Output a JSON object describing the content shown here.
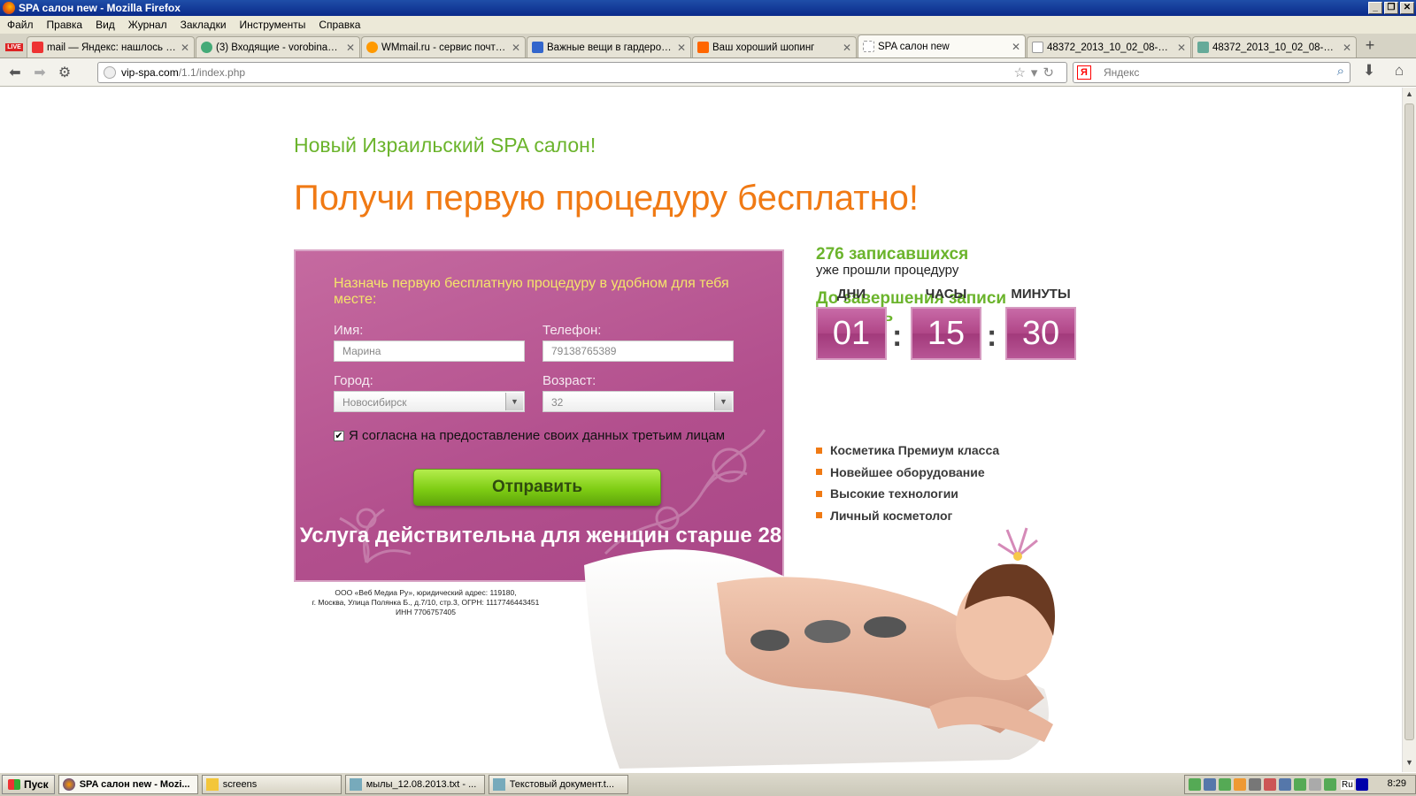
{
  "window": {
    "title": "SPA салон new - Mozilla Firefox"
  },
  "menu": [
    "Файл",
    "Правка",
    "Вид",
    "Журнал",
    "Закладки",
    "Инструменты",
    "Справка"
  ],
  "tabs": [
    {
      "label": "mail — Яндекс: нашлось 27...",
      "favicon": "yandex-icon",
      "color": "#e33"
    },
    {
      "label": "(3) Входящие - vorobina86...",
      "favicon": "mail-icon",
      "color": "#4a7"
    },
    {
      "label": "WMmail.ru - сервис почтов...",
      "favicon": "wmmail-icon",
      "color": "#f90"
    },
    {
      "label": "Важные вещи в гардеробе ...",
      "favicon": "google-icon",
      "color": "#36c"
    },
    {
      "label": "Ваш хороший шопинг",
      "favicon": "blogger-icon",
      "color": "#f60"
    },
    {
      "label": "SPA салон new",
      "favicon": "page-icon",
      "color": "#ddd"
    },
    {
      "label": "48372_2013_10_02_08-26-1...",
      "favicon": "page-icon",
      "color": "#ddd"
    },
    {
      "label": "48372_2013_10_02_08-26-1...",
      "favicon": "image-icon",
      "color": "#6a9"
    }
  ],
  "address": {
    "domain": "vip-spa.com",
    "path": "/1.1/index.php"
  },
  "search": {
    "placeholder": "Яндекс"
  },
  "page": {
    "subtitle": "Новый Израильский SPA салон!",
    "headline": "Получи первую процедуру бесплатно!",
    "form": {
      "intro": "Назначь первую бесплатную процедуру в удобном для тебя месте:",
      "name_label": "Имя:",
      "name_value": "Марина",
      "phone_label": "Телефон:",
      "phone_value": "79138765389",
      "city_label": "Город:",
      "city_value": "Новосибирск",
      "age_label": "Возраст:",
      "age_value": "32",
      "consent_label": "Я согласна на предоставление своих данных третьим лицам",
      "consent_checked": true,
      "submit_label": "Отправить",
      "validity": "Услуга действительна для женщин старше 28"
    },
    "legal": {
      "line1": "ООО «Веб Медиа Ру», юридический адрес: 119180,",
      "line2": "г. Москва, Улица Полянка Б., д.7/10, стр.3, ОГРН: 1117746443451",
      "line3": "ИНН 7706757405"
    },
    "counter": {
      "count": "276 записавшихся",
      "caption": "уже прошли процедуру"
    },
    "deadline": {
      "title": "До завершения записи осталось",
      "days_label": "ДНИ",
      "days": "01",
      "hours_label": "ЧАСЫ",
      "hours": "15",
      "minutes_label": "МИНУТЫ",
      "minutes": "30"
    },
    "features": [
      "Косметика Премиум класса",
      "Новейшее оборудование",
      "Высокие технологии",
      "Личный косметолог"
    ]
  },
  "taskbar": {
    "start": "Пуск",
    "items": [
      {
        "label": "SPA салон new - Mozi...",
        "icon": "firefox-icon"
      },
      {
        "label": "screens",
        "icon": "folder-icon"
      },
      {
        "label": "мылы_12.08.2013.txt - ...",
        "icon": "notepad-icon"
      },
      {
        "label": "Текстовый документ.t...",
        "icon": "notepad-icon"
      }
    ],
    "lang": "Ru",
    "clock": "8:29"
  }
}
